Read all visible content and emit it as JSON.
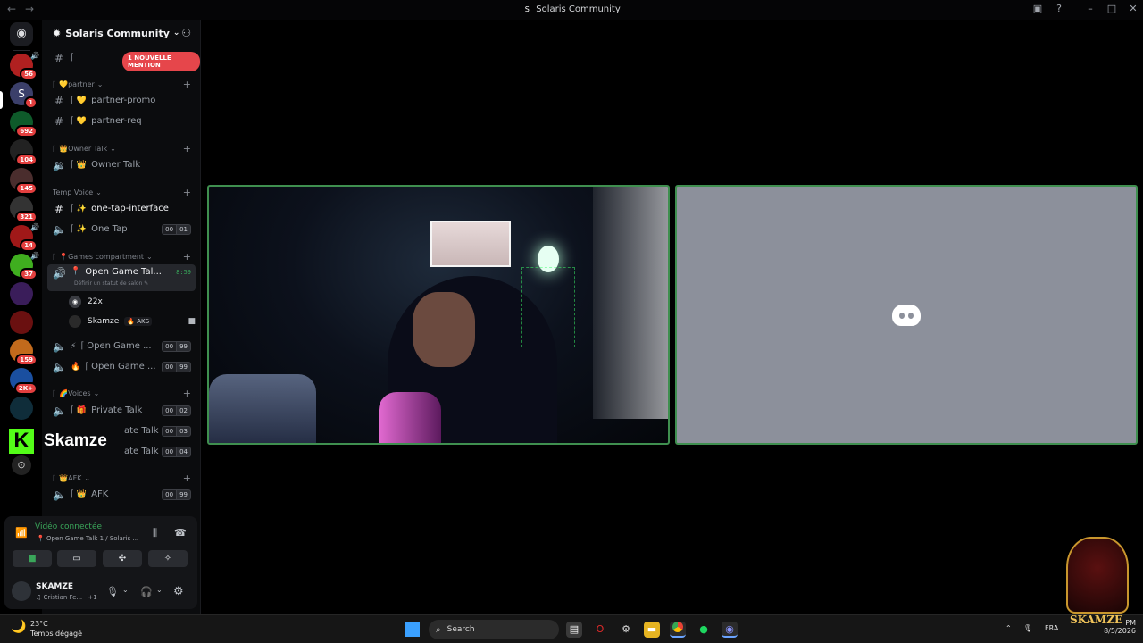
{
  "window": {
    "title": "Solaris Community"
  },
  "server": {
    "name": "Solaris Community"
  },
  "rail": {
    "badges": [
      "56",
      "1",
      "692",
      "104",
      "145",
      "321",
      "14",
      "37",
      "159",
      "2K+"
    ]
  },
  "mention_banner": "1 NOUVELLE MENTION",
  "categories": {
    "partner": "partner",
    "owner_talk": "Owner Talk",
    "temp_voice": "Temp Voice",
    "games": "Games compartment",
    "voices": "Voices",
    "afk": "AFK"
  },
  "channels": {
    "partner_promo": "partner-promo",
    "partner_req": "partner-req",
    "owner_talk": "Owner Talk",
    "one_tap_interface": "one-tap-interface",
    "one_tap": {
      "label": "One Tap",
      "count_a": "00",
      "count_b": "01"
    },
    "open_game_active": {
      "label": "Open Game Tal...",
      "timer": "8:59",
      "status_hint": "Définir un statut de salon"
    },
    "open_game_2": {
      "label": "Open Game ...",
      "count_a": "00",
      "count_b": "99"
    },
    "open_game_3": {
      "label": "Open Game ...",
      "count_a": "00",
      "count_b": "99"
    },
    "private_talk_1": {
      "label": "Private Talk",
      "count_a": "00",
      "count_b": "02"
    },
    "private_talk_2": {
      "label": "ate Talk",
      "count_a": "00",
      "count_b": "03"
    },
    "private_talk_3": {
      "label": "ate Talk",
      "count_a": "00",
      "count_b": "04"
    },
    "afk": {
      "label": "AFK",
      "count_a": "00",
      "count_b": "99"
    }
  },
  "voice_users": [
    {
      "name": "22x"
    },
    {
      "name": "Skamze",
      "tag": "AKS"
    }
  ],
  "overlay": {
    "kick_name": "Skamze",
    "watermark": "SKAMZE"
  },
  "voice_panel": {
    "status": "Vidéo connectée",
    "channel": "Open Game Talk 1 / Solaris ...",
    "user": "SKAMZE",
    "user_status": "Cristian Fe...",
    "user_extra": "+1"
  },
  "taskbar": {
    "temp": "23°C",
    "weather": "Temps dégagé",
    "search": "Search",
    "lang": "FRA",
    "ampm": "PM",
    "date": "8/5/2026"
  },
  "colors": {
    "accent_green": "#3f8f4f",
    "mention_red": "#e6464b",
    "blank_tile": "#8c909b"
  }
}
